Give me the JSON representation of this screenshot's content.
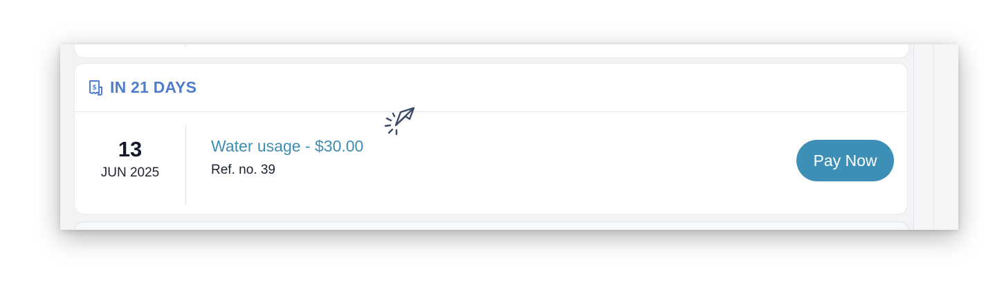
{
  "section": {
    "header_label": "IN 21 DAYS",
    "header_icon": "bill-icon",
    "accent_color": "#4f7ccd"
  },
  "bill": {
    "day": "13",
    "month_year": "JUN 2025",
    "title": "Water usage - $30.00",
    "reference": "Ref. no. 39",
    "title_color": "#3d8db3"
  },
  "actions": {
    "pay_label": "Pay Now",
    "button_color": "#3d8fb5"
  },
  "cursor": {
    "icon": "click-cursor-icon"
  }
}
